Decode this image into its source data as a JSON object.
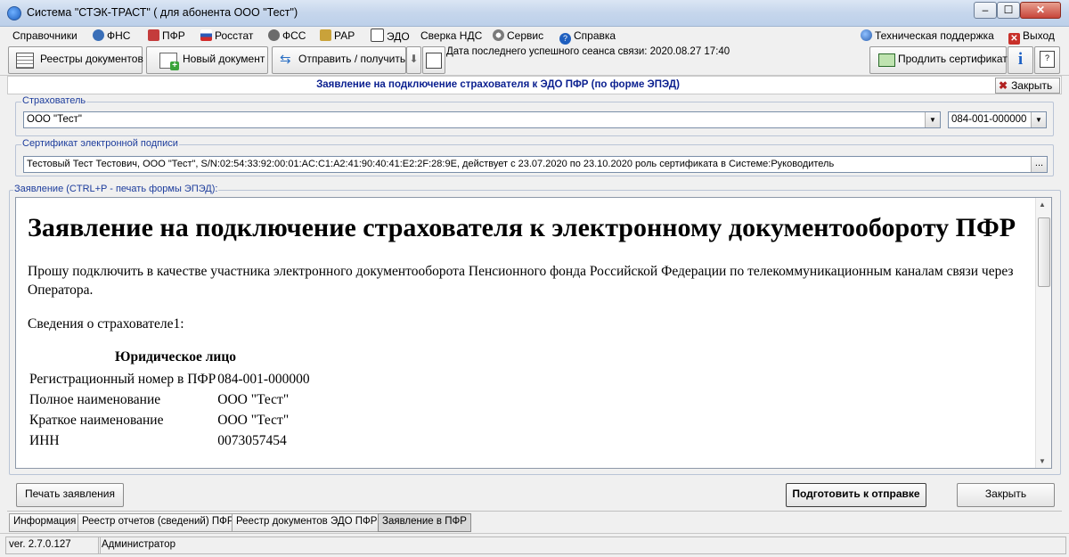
{
  "window": {
    "title": "Система \"СТЭК-ТРАСТ\" ( для абонента ООО \"Тест\")",
    "btn_min": "–",
    "btn_max": "☐",
    "btn_close": "✕"
  },
  "menu": {
    "items": [
      {
        "label": "Справочники",
        "icon": "none"
      },
      {
        "label": "ФНС",
        "icon": "fns-icon"
      },
      {
        "label": "ПФР",
        "icon": "pfr-icon"
      },
      {
        "label": "Росстат",
        "icon": "rosstat-icon"
      },
      {
        "label": "ФСС",
        "icon": "fss-icon"
      },
      {
        "label": "РАР",
        "icon": "rar-icon"
      },
      {
        "label": "ЭДО",
        "icon": "edo-icon"
      },
      {
        "label": "Сверка НДС",
        "icon": "none"
      },
      {
        "label": "Сервис",
        "icon": "gear-icon"
      },
      {
        "label": "Справка",
        "icon": "help-icon"
      }
    ],
    "support": "Техническая поддержка",
    "exit": "Выход"
  },
  "toolbar": {
    "registries": "Реестры документов",
    "new_doc": "Новый документ",
    "send_receive": "Отправить / получить",
    "last_session": "Дата последнего успешного сеанса связи: 2020.08.27 17:40",
    "extend_cert": "Продлить сертификат",
    "info": "i"
  },
  "document": {
    "header_title": "Заявление на подключение страхователя к ЭДО ПФР (по форме ЭПЭД)",
    "close_label": "Закрыть"
  },
  "insurer": {
    "group_label": "Страхователь",
    "name": "ООО \"Тест\"",
    "reg_number": "084-001-000000"
  },
  "certificate": {
    "group_label": "Сертификат электронной подписи",
    "value": "Тестовый Тест Тестович, ООО \"Тест\", S/N:02:54:33:92:00:01:AC:C1:A2:41:90:40:41:E2:2F:28:9E, действует с 23.07.2020 по 23.10.2020 роль сертификата в Системе:Руководитель",
    "browse": "..."
  },
  "statement": {
    "group_label": "Заявление (CTRL+P - печать формы ЭПЭД):",
    "heading": "Заявление на подключение страхователя к электронному документообороту ПФР",
    "para1": "Прошу подключить в качестве участника электронного документооборота Пенсионного фонда Российской Федерации по телекоммуникационным каналам связи через Оператора.",
    "para2": "Сведения о страхователе1:",
    "entity_type": "Юридическое лицо",
    "rows": [
      {
        "label": "Регистрационный номер в ПФР",
        "value": "084-001-000000"
      },
      {
        "label": "Полное наименование",
        "value": "ООО \"Тест\""
      },
      {
        "label": "Краткое наименование",
        "value": "ООО \"Тест\""
      },
      {
        "label": "ИНН",
        "value": "0073057454"
      }
    ]
  },
  "buttons": {
    "print": "Печать заявления",
    "prepare": "Подготовить к отправке",
    "close": "Закрыть"
  },
  "tabs": [
    {
      "label": "Информация",
      "active": false
    },
    {
      "label": "Реестр отчетов (сведений) ПФР",
      "active": false
    },
    {
      "label": "Реестр документов ЭДО ПФР",
      "active": false
    },
    {
      "label": "Заявление в ПФР",
      "active": true
    }
  ],
  "status": {
    "version": "ver. 2.7.0.127",
    "user": "Администратор"
  }
}
